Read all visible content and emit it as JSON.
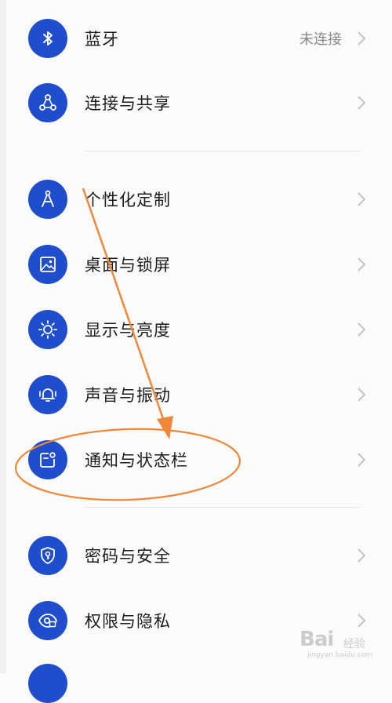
{
  "settings": [
    {
      "label": "蓝牙",
      "status": "未连接",
      "icon": "bluetooth-icon"
    },
    {
      "label": "连接与共享",
      "icon": "share-nodes-icon"
    },
    {
      "label": "个性化定制",
      "icon": "compass-icon"
    },
    {
      "label": "桌面与锁屏",
      "icon": "image-icon"
    },
    {
      "label": "显示与亮度",
      "icon": "sun-icon"
    },
    {
      "label": "声音与振动",
      "icon": "bell-icon"
    },
    {
      "label": "通知与状态栏",
      "icon": "notification-icon"
    },
    {
      "label": "密码与安全",
      "icon": "shield-key-icon"
    },
    {
      "label": "权限与隐私",
      "icon": "eye-lock-icon"
    }
  ],
  "colors": {
    "icon_bg": "#1f4dcc",
    "annotation": "#f0883a"
  },
  "watermark": {
    "logo": "Bai",
    "sub": "经验",
    "url": "jingyan.baidu.com"
  }
}
